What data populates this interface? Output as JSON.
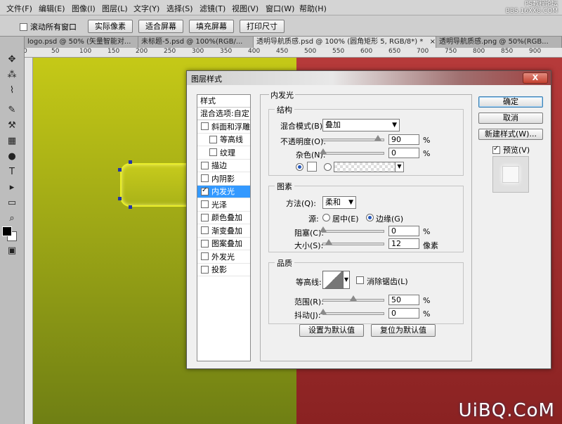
{
  "menu": [
    "文件(F)",
    "编辑(E)",
    "图像(I)",
    "图层(L)",
    "文字(Y)",
    "选择(S)",
    "滤镜(T)",
    "视图(V)",
    "窗口(W)",
    "帮助(H)"
  ],
  "watermark_top": [
    "PS教程论坛",
    "BBS.16XX8.COM"
  ],
  "options": {
    "scroll_all_label": "滚动所有窗口",
    "buttons": [
      "实际像素",
      "适合屏幕",
      "填充屏幕",
      "打印尺寸"
    ]
  },
  "doc_tabs": [
    {
      "label": "logo.psd @ 50% (矢量智能对..."
    },
    {
      "label": "未标题-5.psd @ 100%(RGB/..."
    },
    {
      "label": "透明导航质感.psd @ 100% (圆角矩形 5, RGB/8*) *"
    },
    {
      "label": "透明导航质感.png @ 50%(RGB..."
    }
  ],
  "ruler": [
    "0",
    "50",
    "100",
    "150",
    "200",
    "250",
    "300",
    "350",
    "400",
    "450",
    "500",
    "550",
    "600",
    "650",
    "700",
    "750",
    "800",
    "850",
    "900"
  ],
  "dialog": {
    "title": "图层样式",
    "styles_header": "样式",
    "blend_options": "混合选项:自定",
    "styles": [
      {
        "label": "斜面和浮雕",
        "checked": false,
        "indent": false
      },
      {
        "label": "等高线",
        "checked": false,
        "indent": true
      },
      {
        "label": "纹理",
        "checked": false,
        "indent": true
      },
      {
        "label": "描边",
        "checked": false,
        "indent": false
      },
      {
        "label": "内阴影",
        "checked": false,
        "indent": false
      },
      {
        "label": "内发光",
        "checked": true,
        "indent": false
      },
      {
        "label": "光泽",
        "checked": false,
        "indent": false
      },
      {
        "label": "颜色叠加",
        "checked": false,
        "indent": false
      },
      {
        "label": "渐变叠加",
        "checked": false,
        "indent": false
      },
      {
        "label": "图案叠加",
        "checked": false,
        "indent": false
      },
      {
        "label": "外发光",
        "checked": false,
        "indent": false
      },
      {
        "label": "投影",
        "checked": false,
        "indent": false
      }
    ],
    "panel_title": "内发光",
    "structure": {
      "title": "结构",
      "blend_mode_label": "混合模式(B):",
      "blend_mode_value": "叠加",
      "opacity_label": "不透明度(O):",
      "opacity_value": "90",
      "opacity_unit": "%",
      "noise_label": "杂色(N):",
      "noise_value": "0",
      "noise_unit": "%"
    },
    "elements": {
      "title": "图素",
      "method_label": "方法(Q):",
      "method_value": "柔和",
      "source_label": "源:",
      "source_center": "居中(E)",
      "source_edge": "边缘(G)",
      "choke_label": "阻塞(C):",
      "choke_value": "0",
      "choke_unit": "%",
      "size_label": "大小(S):",
      "size_value": "12",
      "size_unit": "像素"
    },
    "quality": {
      "title": "品质",
      "contour_label": "等高线:",
      "antialias_label": "消除锯齿(L)",
      "range_label": "范围(R):",
      "range_value": "50",
      "range_unit": "%",
      "jitter_label": "抖动(J):",
      "jitter_value": "0",
      "jitter_unit": "%"
    },
    "make_default": "设置为默认值",
    "reset_default": "复位为默认值",
    "ok": "确定",
    "cancel": "取消",
    "new_style": "新建样式(W)...",
    "preview_label": "预览(V)",
    "close": "X"
  },
  "watermark_bottom": "UiBQ.CoM"
}
